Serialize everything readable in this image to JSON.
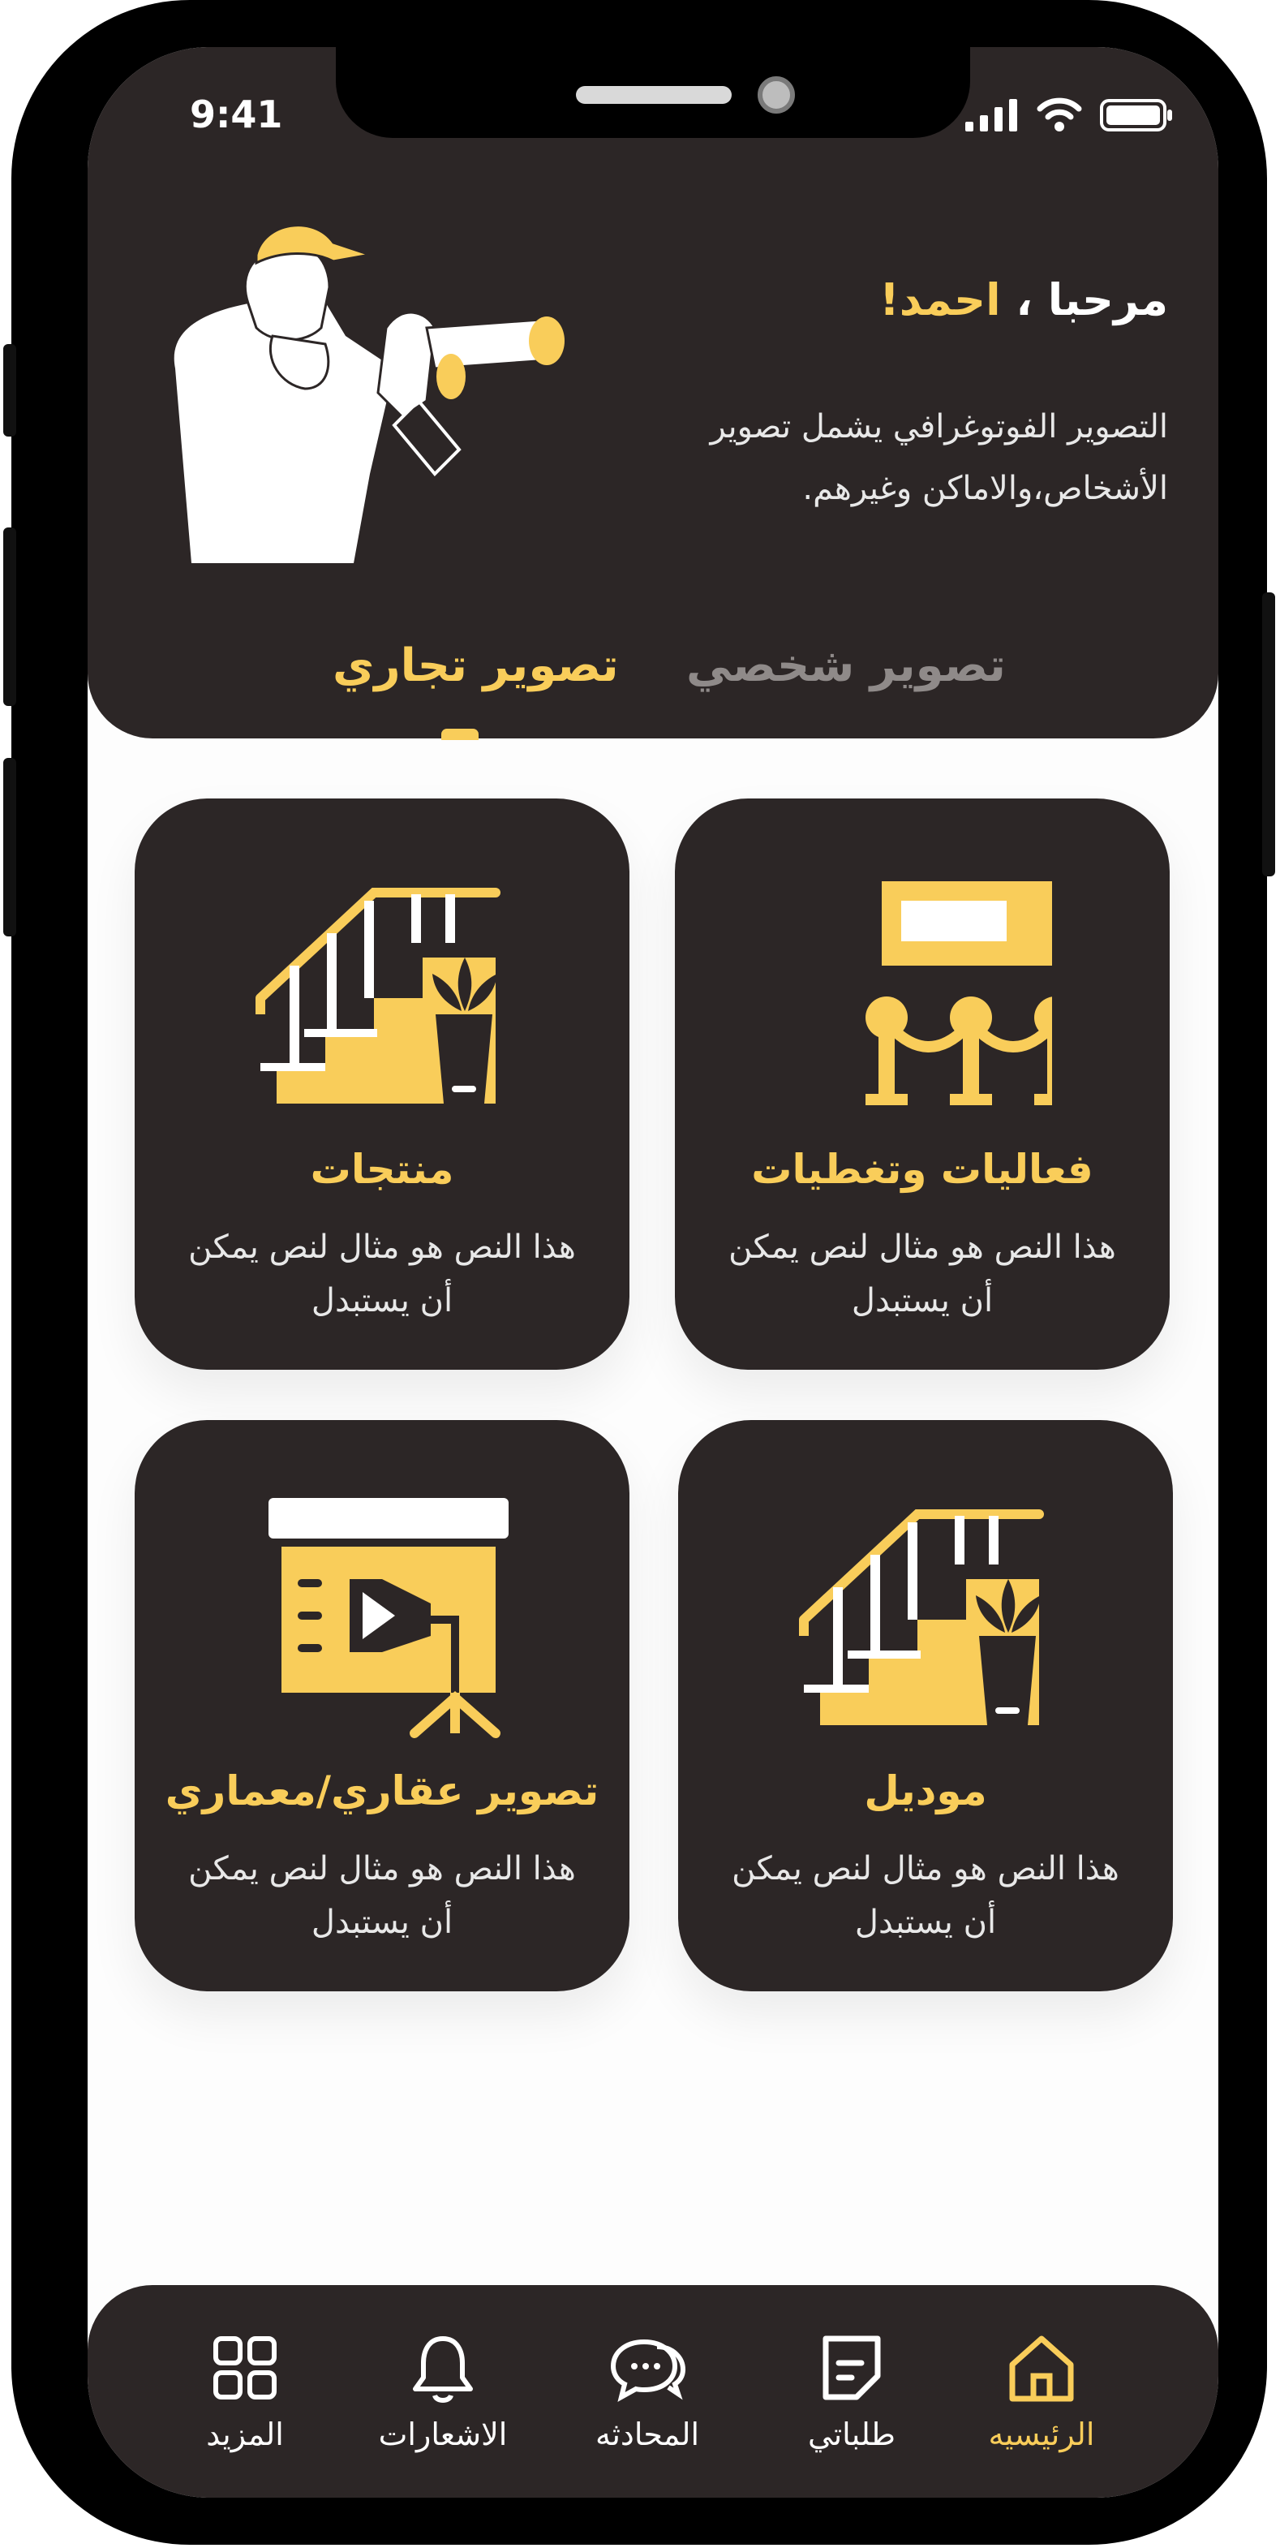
{
  "status_bar": {
    "time": "9:41"
  },
  "header": {
    "greeting": "مرحبا ،",
    "user_name": "احمد!",
    "intro_text": "التصوير الفوتوغرافي يشمل تصوير الأشخاص،والاماكن وغيرهم.",
    "illustration": "photographer-with-binoculars"
  },
  "tabs": [
    {
      "label": "تصوير شخصي",
      "active": false
    },
    {
      "label": "تصوير تجاري",
      "active": true
    }
  ],
  "categories": [
    {
      "title": "فعاليات وتغطيات",
      "description": "هذا النص هو مثال لنص يمكن أن يستبدل",
      "icon": "event-barrier-icon"
    },
    {
      "title": "منتجات",
      "description": "هذا النص هو مثال لنص يمكن أن يستبدل",
      "icon": "stairs-plant-icon"
    },
    {
      "title": "موديل",
      "description": "هذا النص هو مثال لنص يمكن أن يستبدل",
      "icon": "stairs-plant-icon"
    },
    {
      "title": "تصوير عقاري/معماري",
      "description": "هذا النص هو مثال لنص يمكن أن يستبدل",
      "icon": "projector-screen-icon"
    }
  ],
  "bottom_nav": [
    {
      "label": "الرئيسيه",
      "icon": "home-icon",
      "active": true
    },
    {
      "label": "طلباتي",
      "icon": "note-icon",
      "active": false
    },
    {
      "label": "المحادثه",
      "icon": "chat-icon",
      "active": false
    },
    {
      "label": "الاشعارات",
      "icon": "bell-icon",
      "active": false
    },
    {
      "label": "المزيد",
      "icon": "grid-icon",
      "active": false
    }
  ],
  "colors": {
    "dark": "#2c2626",
    "accent": "#f9cd5a",
    "muted": "#8f8a89",
    "background": "#fdfdfd"
  }
}
